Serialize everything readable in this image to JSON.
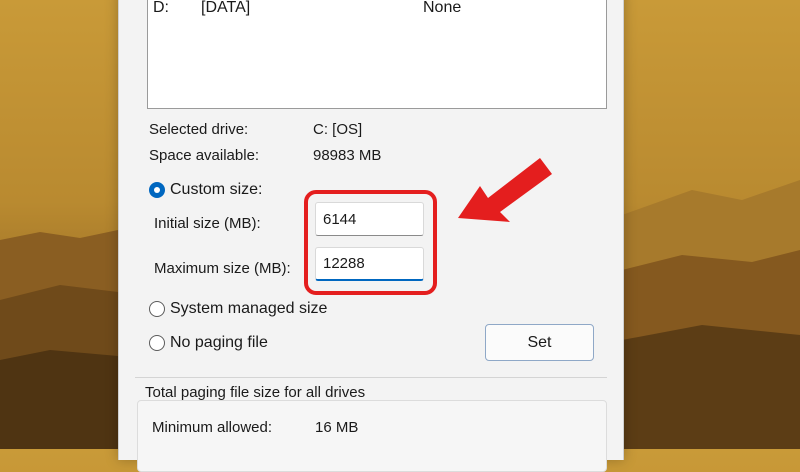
{
  "drive_list": {
    "rows": [
      {
        "drive": "D:",
        "label": "[DATA]",
        "paging": "None"
      }
    ]
  },
  "selected_drive": {
    "label": "Selected drive:",
    "value": "C:  [OS]"
  },
  "space_available": {
    "label": "Space available:",
    "value": "98983 MB"
  },
  "options": {
    "custom_size": {
      "label": "Custom size:",
      "checked": true
    },
    "system_managed": {
      "label": "System managed size",
      "checked": false
    },
    "no_paging": {
      "label": "No paging file",
      "checked": false
    }
  },
  "initial_size": {
    "label": "Initial size (MB):",
    "value": "6144"
  },
  "maximum_size": {
    "label": "Maximum size (MB):",
    "value": "12288"
  },
  "set_button": {
    "label": "Set"
  },
  "totals": {
    "title": "Total paging file size for all drives",
    "minimum": {
      "label": "Minimum allowed:",
      "value": "16 MB"
    }
  },
  "colors": {
    "accent": "#0067c0",
    "highlight": "#e41e1e"
  }
}
